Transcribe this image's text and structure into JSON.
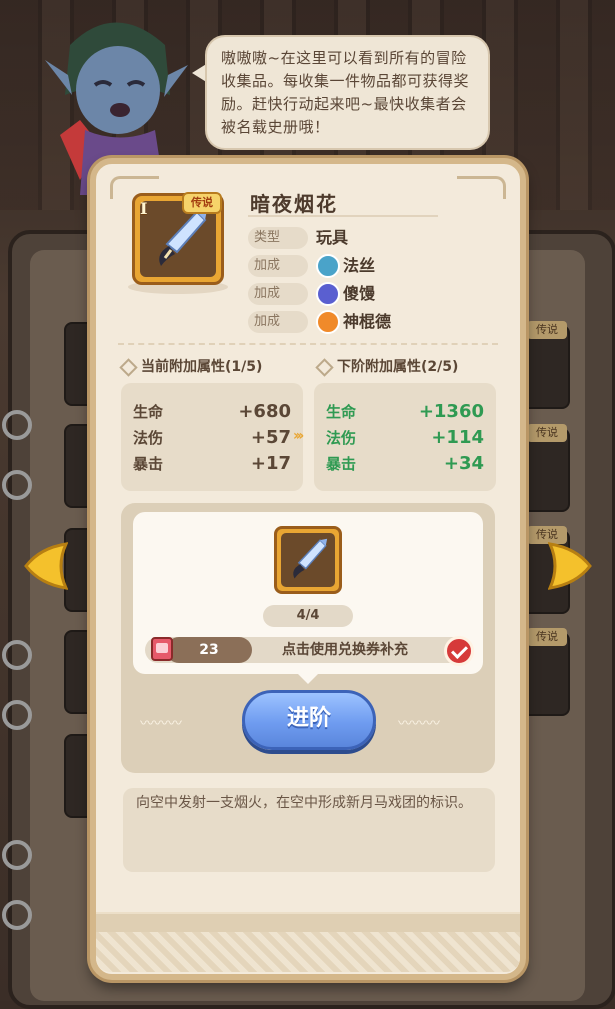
{
  "speech": {
    "text": "嗷嗷嗷~在这里可以看到所有的冒险收集品。每收集一件物品都可获得奖励。赶快行动起来吧~最快收集者会被名载史册哦！"
  },
  "background_tags": [
    "传说",
    "传说",
    "传说",
    "传说"
  ],
  "item": {
    "tier": "I",
    "rarity": "传说",
    "name": "暗夜烟花",
    "type_label": "类型",
    "type_value": "玩具",
    "bonuses": [
      {
        "label": "加成",
        "name": "法丝",
        "icon_color": "#4aa3c9"
      },
      {
        "label": "加成",
        "name": "傻馒",
        "icon_color": "#5a5fd0"
      },
      {
        "label": "加成",
        "name": "神棍德",
        "icon_color": "#f08a2a"
      }
    ]
  },
  "current_attrs": {
    "title": "当前附加属性(1/5)",
    "stats": [
      {
        "name": "生命",
        "value": "+680"
      },
      {
        "name": "法伤",
        "value": "+57"
      },
      {
        "name": "暴击",
        "value": "+17"
      }
    ]
  },
  "next_attrs": {
    "title": "下阶附加属性(2/5)",
    "stats": [
      {
        "name": "生命",
        "value": "+1360"
      },
      {
        "name": "法伤",
        "value": "+114"
      },
      {
        "name": "暴击",
        "value": "+34"
      }
    ]
  },
  "upgrade": {
    "progress": "4/4",
    "voucher_count": "23",
    "voucher_hint": "点击使用兑换券补充",
    "button_label": "进阶"
  },
  "description": "向空中发射一支烟火，在空中形成新月马戏团的标识。",
  "colors": {
    "stat_next": "#2f9a52",
    "button": "#6f9cf0",
    "legendary_frame": "#e9a633"
  }
}
